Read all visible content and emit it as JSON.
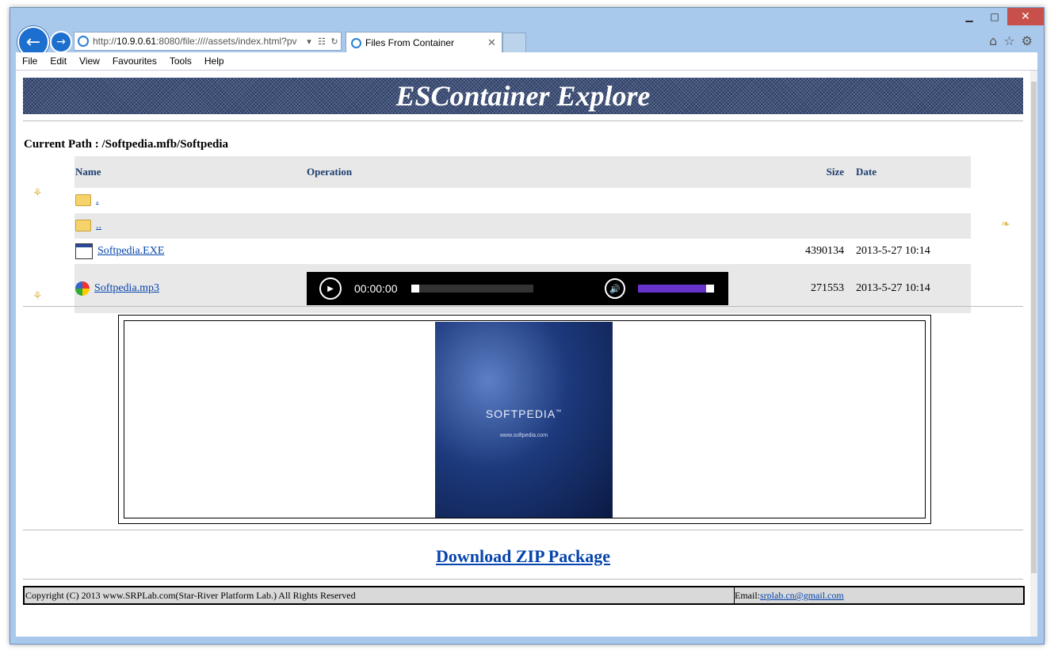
{
  "browser": {
    "address_prefix": "http://",
    "address_host": "10.9.0.61",
    "address_rest": ":8080/file:////assets/index.html?pv",
    "tab_title": "Files From Container",
    "menu": [
      "File",
      "Edit",
      "View",
      "Favourites",
      "Tools",
      "Help"
    ]
  },
  "page": {
    "banner_title": "ESContainer Explore",
    "current_path": "Current Path : /Softpedia.mfb/Softpedia",
    "columns": {
      "name": "Name",
      "operation": "Operation",
      "size": "Size",
      "date": "Date"
    },
    "rows": [
      {
        "name": ".",
        "type": "folder",
        "size": "",
        "date": ""
      },
      {
        "name": "..",
        "type": "folder",
        "size": "",
        "date": ""
      },
      {
        "name": "Softpedia.EXE",
        "type": "exe",
        "size": "4390134",
        "date": "2013-5-27 10:14"
      },
      {
        "name": "Softpedia.mp3",
        "type": "audio",
        "size": "271553",
        "date": "2013-5-27 10:14"
      }
    ],
    "player": {
      "time": "00:00:00",
      "progress": 0.0,
      "volume": 0.9
    },
    "cover": {
      "title": "SOFTPEDIA",
      "trademark": "™",
      "url": "www.softpedia.com"
    },
    "download_label": "Download ZIP Package",
    "footer_copyright": "Copyright (C) 2013 www.SRPLab.com(Star-River Platform Lab.) All Rights Reserved",
    "footer_email_label": "Email:",
    "footer_email": "srplab.cn@gmail.com"
  },
  "colors": {
    "banner": "#2a3c66",
    "link": "#0645ad",
    "row_alt": "#e8e8e8",
    "volume": "#6633cc"
  }
}
